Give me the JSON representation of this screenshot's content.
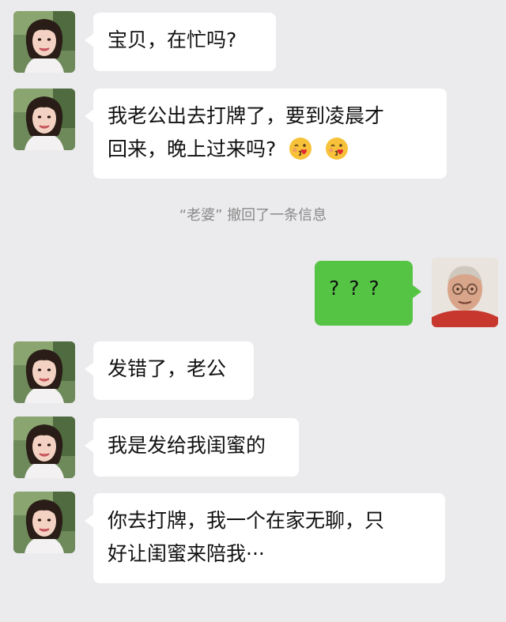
{
  "messages": [
    {
      "side": "left",
      "lines": [
        "宝贝，在忙吗?"
      ]
    },
    {
      "side": "left",
      "lines": [
        "我老公出去打牌了，要到凌晨才",
        "回来，晚上过来吗?"
      ],
      "emojis": [
        "kissing-face-with-heart-icon",
        "kissing-face-with-heart-icon"
      ]
    },
    {
      "side": "system",
      "name": "“老婆”",
      "text": "撤回了一条信息"
    },
    {
      "side": "right",
      "lines": [
        "? ? ?"
      ]
    },
    {
      "side": "left",
      "lines": [
        "发错了，老公"
      ]
    },
    {
      "side": "left",
      "lines": [
        "我是发给我闺蜜的"
      ]
    },
    {
      "side": "left",
      "lines": [
        "你去打牌，我一个在家无聊，只",
        "好让闺蜜来陪我···"
      ]
    }
  ],
  "colors": {
    "background": "#ebeaed",
    "incoming_bubble": "#ffffff",
    "outgoing_bubble": "#55c444"
  }
}
